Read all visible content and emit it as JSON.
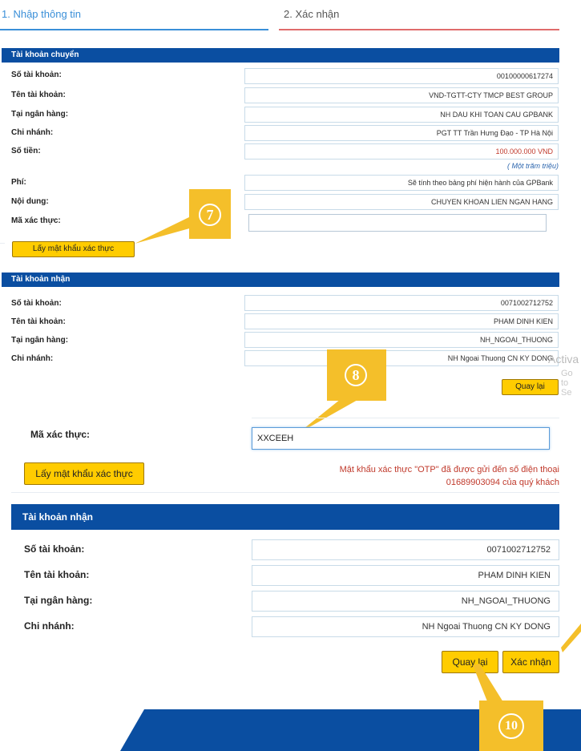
{
  "steps": {
    "step1": "1. Nhập thông tin",
    "step2": "2. Xác nhận"
  },
  "transfer_account": {
    "title": "Tài khoản chuyển",
    "rows": [
      {
        "label": "Số tài khoản:",
        "value": "00100000617274"
      },
      {
        "label": "Tên tài khoản:",
        "value": "VND-TGTT-CTY TMCP BEST GROUP"
      },
      {
        "label": "Tại ngân hàng:",
        "value": "NH DAU KHI TOAN CAU GPBANK"
      },
      {
        "label": "Chi nhánh:",
        "value": "PGT TT Trần Hưng Đạo - TP Hà Nội"
      },
      {
        "label": "Số tiền:",
        "value": "100.000.000 VND"
      }
    ],
    "amount_words": "( Một trăm triệu)",
    "fee_label": "Phí:",
    "fee_value": "Sẽ tính theo bảng phí hiện hành của GPBank",
    "content_label": "Nội dung:",
    "content_value": "CHUYEN KHOAN LIEN NGAN HANG",
    "auth_label": "Mã xác thực:",
    "auth_value": "",
    "get_code_button": "Lấy mật khẩu xác thực"
  },
  "receive_account_small": {
    "title": "Tài khoản nhận",
    "rows": [
      {
        "label": "Số tài khoản:",
        "value": "0071002712752"
      },
      {
        "label": "Tên tài khoản:",
        "value": "PHAM DINH KIEN"
      },
      {
        "label": "Tại ngân hàng:",
        "value": "NH_NGOAI_THUONG"
      },
      {
        "label": "Chi nhánh:",
        "value": "NH Ngoai Thuong CN KY DONG"
      }
    ],
    "back_button": "Quay lại"
  },
  "watermark": {
    "line1": "Activa",
    "line2": "Go to Se"
  },
  "confirm_block": {
    "auth_label": "Mã xác thực:",
    "auth_value": "XXCEEH",
    "get_code_button": "Lấy mật khẩu xác thực",
    "otp_message_line1": "Mật khẩu xác thực \"OTP\" đã được gửi đến số điện thoại",
    "otp_message_line2": "01689903094 của quý khách"
  },
  "receive_account_large": {
    "title": "Tài khoản nhận",
    "rows": [
      {
        "label": "Số tài khoản:",
        "value": "0071002712752"
      },
      {
        "label": "Tên tài khoản:",
        "value": "PHAM DINH KIEN"
      },
      {
        "label": "Tại ngân hàng:",
        "value": "NH_NGOAI_THUONG"
      },
      {
        "label": "Chi nhánh:",
        "value": "NH Ngoai Thuong CN KY DONG"
      }
    ],
    "back_button": "Quay lại",
    "confirm_button": "Xác nhận"
  },
  "callouts": {
    "seven": "7",
    "eight": "8",
    "ten": "10"
  },
  "colors": {
    "header_blue": "#0a4ea1",
    "button_yellow": "#ffcc00",
    "callout_orange": "#f4bf2a",
    "amount_red": "#c0392b"
  }
}
